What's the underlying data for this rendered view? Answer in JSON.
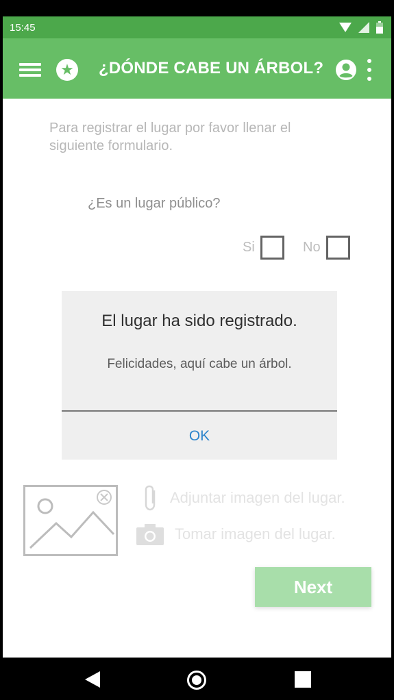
{
  "status_bar": {
    "time": "15:45",
    "icons": [
      "wifi-icon",
      "signal-icon",
      "battery-icon"
    ]
  },
  "app_bar": {
    "title": "¿DÓNDE CABE UN ÁRBOL?",
    "icons": [
      "menu-icon",
      "star-icon",
      "account-icon",
      "more-vert-icon"
    ],
    "color": "#67be66"
  },
  "form": {
    "intro": "Para registrar el lugar por favor llenar el siguiente formulario.",
    "question": "¿Es un lugar público?",
    "option_yes": "Si",
    "option_no": "No",
    "attach_label": "Adjuntar imagen del lugar.",
    "camera_label": "Tomar imagen del lugar.",
    "next_label": "Next"
  },
  "dialog": {
    "title": "El lugar ha sido registrado.",
    "message": "Felicidades, aquí cabe un árbol.",
    "ok_label": "OK"
  },
  "nav_bar": {
    "icons": [
      "back-icon",
      "home-icon",
      "recents-icon"
    ]
  }
}
